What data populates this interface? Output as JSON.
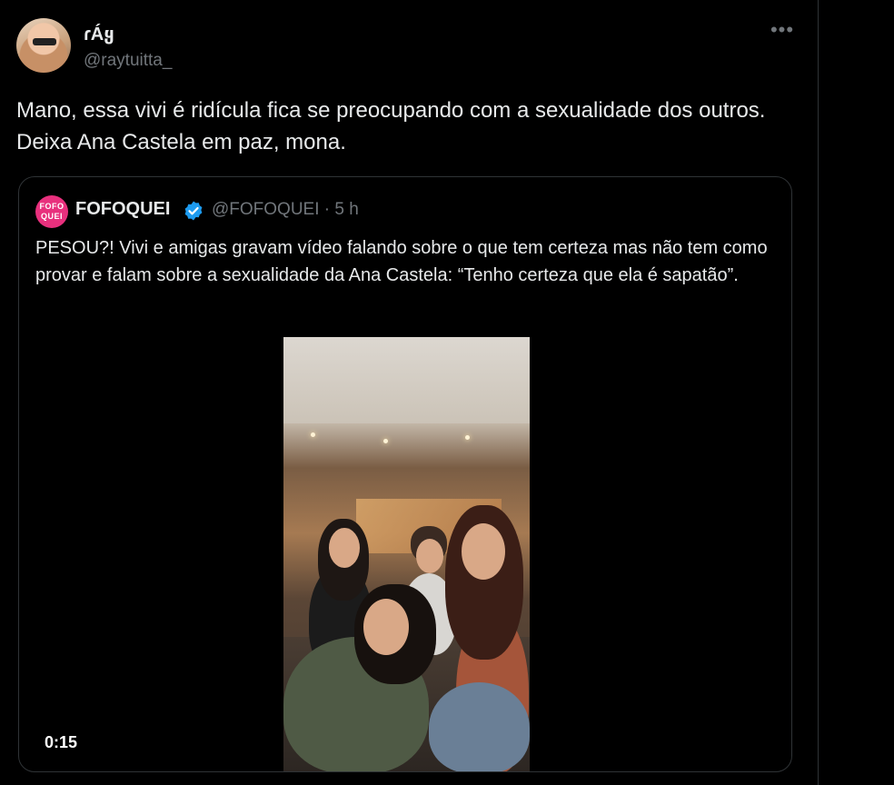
{
  "tweet": {
    "author": {
      "display_name": "ɾÁყ",
      "handle": "@raytuitta_"
    },
    "more_icon": "more-dots-icon",
    "text": "Mano, essa vivi é ridícula fica se preocupando com a sexualidade dos outros. Deixa Ana Castela em paz, mona.",
    "quoted": {
      "avatar_label": "FOFO QUEI",
      "avatar_color": "#e8307d",
      "display_name": "FOFOQUEI",
      "verified_icon": "verified-badge-icon",
      "verified_color": "#1d9bf0",
      "handle_time": "@FOFOQUEI · 5 h",
      "text": "PESOU?! Vivi e amigas gravam vídeo falando sobre o que tem certeza mas não tem como provar e falam sobre a sexualidade da Ana Castela: “Tenho certeza que ela é sapatão”.",
      "video": {
        "duration": "0:15"
      }
    }
  },
  "colors": {
    "background": "#000000",
    "text": "#e7e9ea",
    "secondary_text": "#71767b",
    "border": "#2f3336"
  }
}
